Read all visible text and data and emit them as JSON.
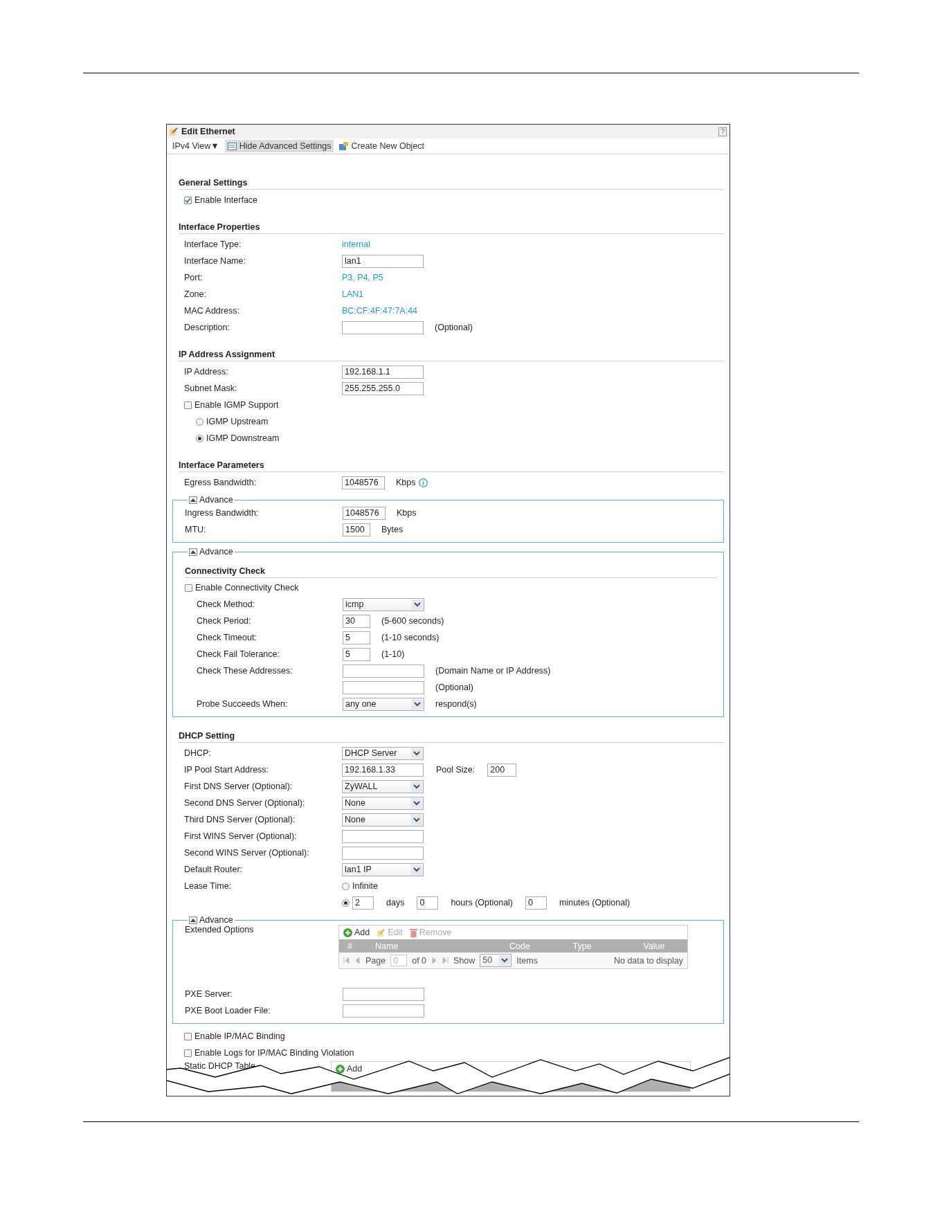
{
  "dialog": {
    "title": "Edit Ethernet",
    "help": "?"
  },
  "toolbar": [
    {
      "kind": "menu",
      "label": "IPv4 View",
      "caret": "▼"
    },
    {
      "kind": "toggle",
      "label": "Hide Advanced Settings",
      "selected": true
    },
    {
      "kind": "create",
      "label": "Create New Object"
    }
  ],
  "sections": [
    {
      "title": "General Settings",
      "rows": [
        {
          "kind": "checkbox",
          "label": "Enable Interface",
          "checked": true
        }
      ]
    },
    {
      "title": "Interface Properties",
      "rows": [
        {
          "kind": "text",
          "label": "Interface Type:",
          "value": "internal"
        },
        {
          "kind": "input",
          "label": "Interface Name:",
          "value": "lan1"
        },
        {
          "kind": "text",
          "label": "Port:",
          "value": "P3, P4, P5"
        },
        {
          "kind": "text",
          "label": "Zone:",
          "value": "LAN1"
        },
        {
          "kind": "text",
          "label": "MAC Address:",
          "value": "BC:CF:4F:47:7A:44"
        },
        {
          "kind": "input",
          "label": "Description:",
          "note": "(Optional)"
        }
      ]
    },
    {
      "title": "IP Address Assignment",
      "rows": [
        {
          "kind": "input",
          "label": "IP Address:",
          "value": "192.168.1.1"
        },
        {
          "kind": "input",
          "label": "Subnet Mask:",
          "value": "255.255.255.0"
        },
        {
          "kind": "checkbox",
          "label": "Enable IGMP Support",
          "checked": false,
          "children": [
            {
              "kind": "radio",
              "label": "IGMP Upstream",
              "selected": false
            },
            {
              "kind": "radio",
              "label": "IGMP Downstream",
              "selected": true
            }
          ]
        }
      ]
    },
    {
      "title": "Interface Parameters",
      "rows": [
        {
          "kind": "number",
          "label": "Egress Bandwidth:",
          "value": "1048576",
          "note": "Kbps",
          "info": true
        },
        {
          "kind": "advance",
          "label": "Advance",
          "expanded": true,
          "rows": [
            {
              "kind": "number",
              "label": "Ingress Bandwidth:",
              "value": "1048576",
              "note": "Kbps"
            },
            {
              "kind": "short",
              "label": "MTU:",
              "value": "1500",
              "note": "Bytes"
            }
          ]
        },
        {
          "kind": "advance",
          "label": "Advance",
          "expanded": true,
          "rows": [
            {
              "kind": "heading",
              "label": "Connectivity Check"
            },
            {
              "kind": "checkbox",
              "label": "Enable Connectivity Check",
              "checked": false,
              "children": [
                {
                  "kind": "select",
                  "label": "Check Method:",
                  "value": "icmp"
                },
                {
                  "kind": "short",
                  "label": "Check Period:",
                  "value": "30",
                  "note": "(5-600 seconds)"
                },
                {
                  "kind": "short",
                  "label": "Check Timeout:",
                  "value": "5",
                  "note": "(1-10 seconds)"
                },
                {
                  "kind": "short",
                  "label": "Check Fail Tolerance:",
                  "value": "5",
                  "note": "(1-10)"
                },
                {
                  "kind": "input",
                  "label": "Check These Addresses:",
                  "note": "(Domain Name or IP Address)"
                },
                {
                  "kind": "input",
                  "note": "(Optional)"
                },
                {
                  "kind": "select",
                  "label": "Probe Succeeds When:",
                  "value": "any one",
                  "note": "respond(s)"
                }
              ]
            }
          ]
        }
      ]
    },
    {
      "title": "DHCP Setting",
      "rows": [
        {
          "kind": "select",
          "label": "DHCP:",
          "value": "DHCP Server"
        },
        {
          "kind": "input",
          "label": "IP Pool Start Address:",
          "value": "192.168.1.33",
          "extra": {
            "label": "Pool Size:",
            "value": "200"
          }
        },
        {
          "kind": "select",
          "label": "First DNS Server (Optional):",
          "value": "ZyWALL"
        },
        {
          "kind": "select",
          "label": "Second DNS Server (Optional):",
          "value": "None"
        },
        {
          "kind": "select",
          "label": "Third DNS Server (Optional):",
          "value": "None"
        },
        {
          "kind": "input",
          "label": "First WINS Server (Optional):"
        },
        {
          "kind": "input",
          "label": "Second WINS Server (Optional):"
        },
        {
          "kind": "select",
          "label": "Default Router:",
          "value": "lan1 IP"
        },
        {
          "kind": "choice",
          "label": "Lease Time:",
          "option": "Infinite",
          "selected": false
        },
        {
          "kind": "duration",
          "selected": true,
          "parts": [
            {
              "value": "2",
              "unit": "days"
            },
            {
              "value": "0",
              "unit": "hours (Optional)"
            },
            {
              "value": "0",
              "unit": "minutes (Optional)"
            }
          ]
        },
        {
          "kind": "advance",
          "label": "Advance",
          "expanded": true,
          "rows": [
            {
              "kind": "table",
              "label": "Extended Options",
              "actions": [
                {
                  "kind": "add",
                  "label": "Add",
                  "disabled": false
                },
                {
                  "kind": "edit",
                  "label": "Edit",
                  "disabled": true
                },
                {
                  "kind": "remove",
                  "label": "Remove",
                  "disabled": true
                }
              ],
              "columns": [
                "#",
                "Name",
                "Code",
                "Type",
                "Value"
              ],
              "pager": {
                "page_label": "Page",
                "page": "0",
                "of": "of 0",
                "show": "Show",
                "per_page": "50",
                "items": "Items",
                "empty": "No data to display"
              }
            },
            {
              "kind": "input",
              "label": "PXE Server:"
            },
            {
              "kind": "input",
              "label": "PXE Boot Loader File:"
            }
          ]
        },
        {
          "kind": "checkbox",
          "label": "Enable IP/MAC Binding",
          "checked": false
        },
        {
          "kind": "checkbox",
          "label": "Enable Logs for IP/MAC Binding Violation",
          "checked": false
        },
        {
          "kind": "torn",
          "label": "Static DHCP Table",
          "actions": [
            {
              "kind": "add",
              "label": "Add",
              "disabled": false
            }
          ]
        }
      ]
    }
  ]
}
